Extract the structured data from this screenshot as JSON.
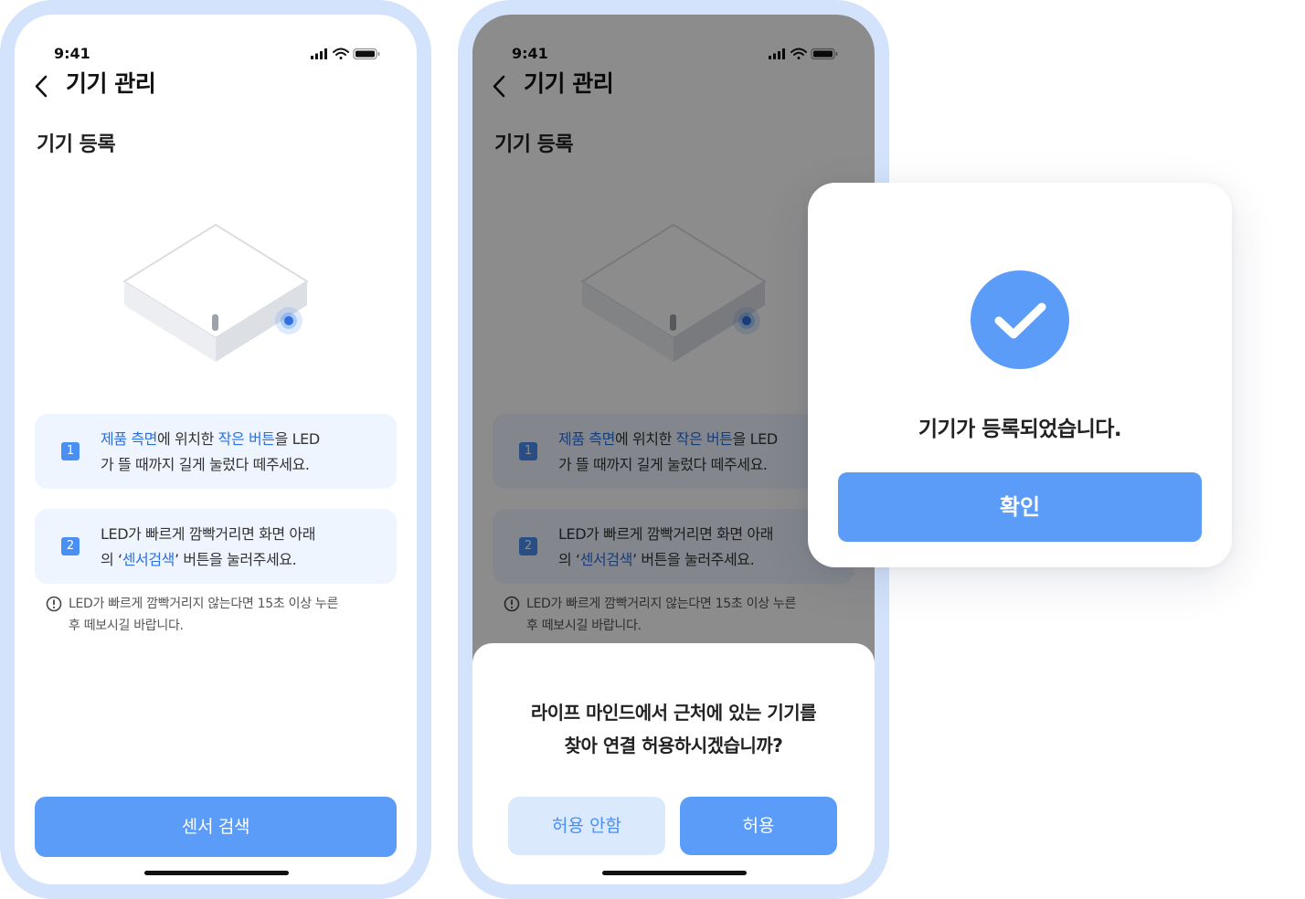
{
  "colors": {
    "accent": "#5b9cf8",
    "accent_light": "#dbe9fd",
    "card_bg": "#eef5ff",
    "phone_frame": "#d3e3fb",
    "highlight_text": "#2c6fe0"
  },
  "status_bar": {
    "time": "9:41"
  },
  "nav": {
    "title": "기기 관리",
    "back_icon": "chevron-left-icon"
  },
  "section_title": "기기 등록",
  "steps": [
    {
      "number": "1",
      "hl1": "제품 측면",
      "mid": "에 위치한 ",
      "hl2": "작은 버튼",
      "tail": "을 LED",
      "line2": "가 뜰 때까지 길게 눌렀다 떼주세요."
    },
    {
      "number": "2",
      "line1": "LED가 빠르게 깜빡거리면 화면 아래",
      "pre": "의 ‘",
      "hl": "센서검색",
      "post": "’ 버튼을 눌러주세요."
    }
  ],
  "note": {
    "icon": "info-circle-icon",
    "line1": "LED가 빠르게 깜빡거리지 않는다면 15초 이상 누른",
    "line2": "후 떼보시길 바랍니다."
  },
  "primary_button": "센서 검색",
  "permission_sheet": {
    "line1": "라이프 마인드에서 근처에 있는 기기를",
    "line2": "찾아 연결 허용하시겠습니까?",
    "deny_label": "허용 안함",
    "allow_label": "허용"
  },
  "success_modal": {
    "icon": "check-circle-icon",
    "message": "기기가 등록되었습니다.",
    "confirm_label": "확인"
  }
}
